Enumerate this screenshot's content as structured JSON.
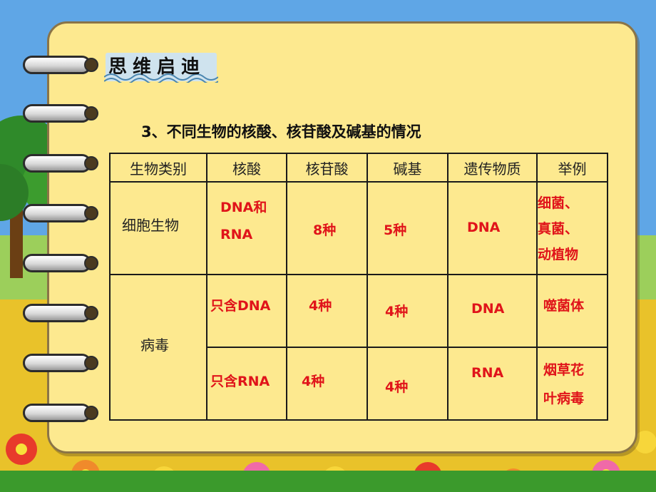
{
  "heading": "思维启迪",
  "subtitle": "3、不同生物的核酸、核苷酸及碱基的情况",
  "table": {
    "headers": [
      "生物类别",
      "核酸",
      "核苷酸",
      "碱基",
      "遗传物质",
      "举例"
    ],
    "cellular": {
      "category": "细胞生物",
      "nucleic_acid_line1": "DNA和",
      "nucleic_acid_line2": "RNA",
      "nucleotides": "8种",
      "bases": "5种",
      "genetic_material": "DNA",
      "example_line1": "细菌、",
      "example_line2": "真菌、",
      "example_line3": "动植物"
    },
    "virus": {
      "category": "病毒",
      "dna_virus": {
        "nucleic_acid": "只含DNA",
        "nucleotides": "4种",
        "bases": "4种",
        "genetic_material": "DNA",
        "example": "噬菌体"
      },
      "rna_virus": {
        "nucleic_acid": "只含RNA",
        "nucleotides": "4种",
        "bases": "4种",
        "genetic_material": "RNA",
        "example_line1": "烟草花",
        "example_line2": "叶病毒"
      }
    }
  },
  "colors": {
    "answer_red": "#e0141a",
    "paper": "#fde98f",
    "heading_box": "#cfe3ee"
  }
}
